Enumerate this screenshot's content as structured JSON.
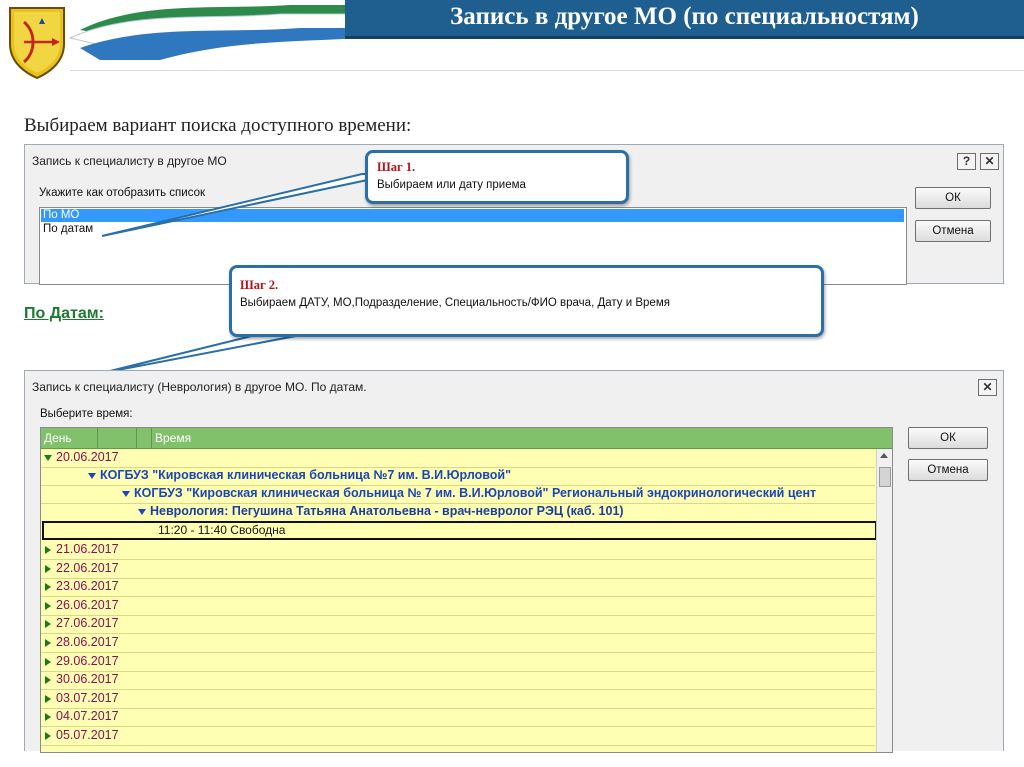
{
  "slide": {
    "title": "Запись в другое МО (по специальностям)",
    "subtitle": "Выбираем вариант поиска доступного времени:",
    "by_dates_label": "По Датам:"
  },
  "dialog1": {
    "title": "Запись к специалисту в другое МО",
    "help_button": "?",
    "close_button": "✕",
    "prompt": "Укажите как отобразить список",
    "options": [
      "По МО",
      "По датам"
    ],
    "selected_option": "По МО",
    "ok_button": "ОК",
    "cancel_button": "Отмена"
  },
  "callout1": {
    "title": "Шаг 1.",
    "text": "Выбираем или  дату приема"
  },
  "callout2": {
    "title": "Шаг 2.",
    "text": "Выбираем ДАТУ, МО,Подразделение,  Специальность/ФИО врача, Дату и Время"
  },
  "dialog2": {
    "title": "Запись к специалисту (Неврология) в другое МО. По датам.",
    "close_button": "✕",
    "prompt": "Выберите время:",
    "columns": [
      "День",
      "Время"
    ],
    "ok_button": "ОК",
    "cancel_button": "Отмена",
    "expanded_date": "20.06.2017",
    "mo_name": "КОГБУЗ \"Кировская клиническая больница №7 им. В.И.Юрловой\"",
    "subdivision": "КОГБУЗ \"Кировская клиническая больница № 7 им. В.И.Юрловой\" Региональный эндокринологический цент",
    "department": "Неврология: Пегушина Татьяна Анатольевна - врач-невролог РЭЦ (каб. 101)",
    "slot": "11:20 - 11:40 Свободна",
    "collapsed_dates": [
      "21.06.2017",
      "22.06.2017",
      "23.06.2017",
      "26.06.2017",
      "27.06.2017",
      "28.06.2017",
      "29.06.2017",
      "30.06.2017",
      "03.07.2017",
      "04.07.2017",
      "05.07.2017"
    ]
  },
  "colors": {
    "header_bg": "#1f5f8f",
    "grid_header": "#82c16b",
    "grid_rows": "#ffffb4",
    "selection": "#3399ff",
    "callout_border": "#2a6fa6",
    "callout_title": "#b4151b"
  }
}
